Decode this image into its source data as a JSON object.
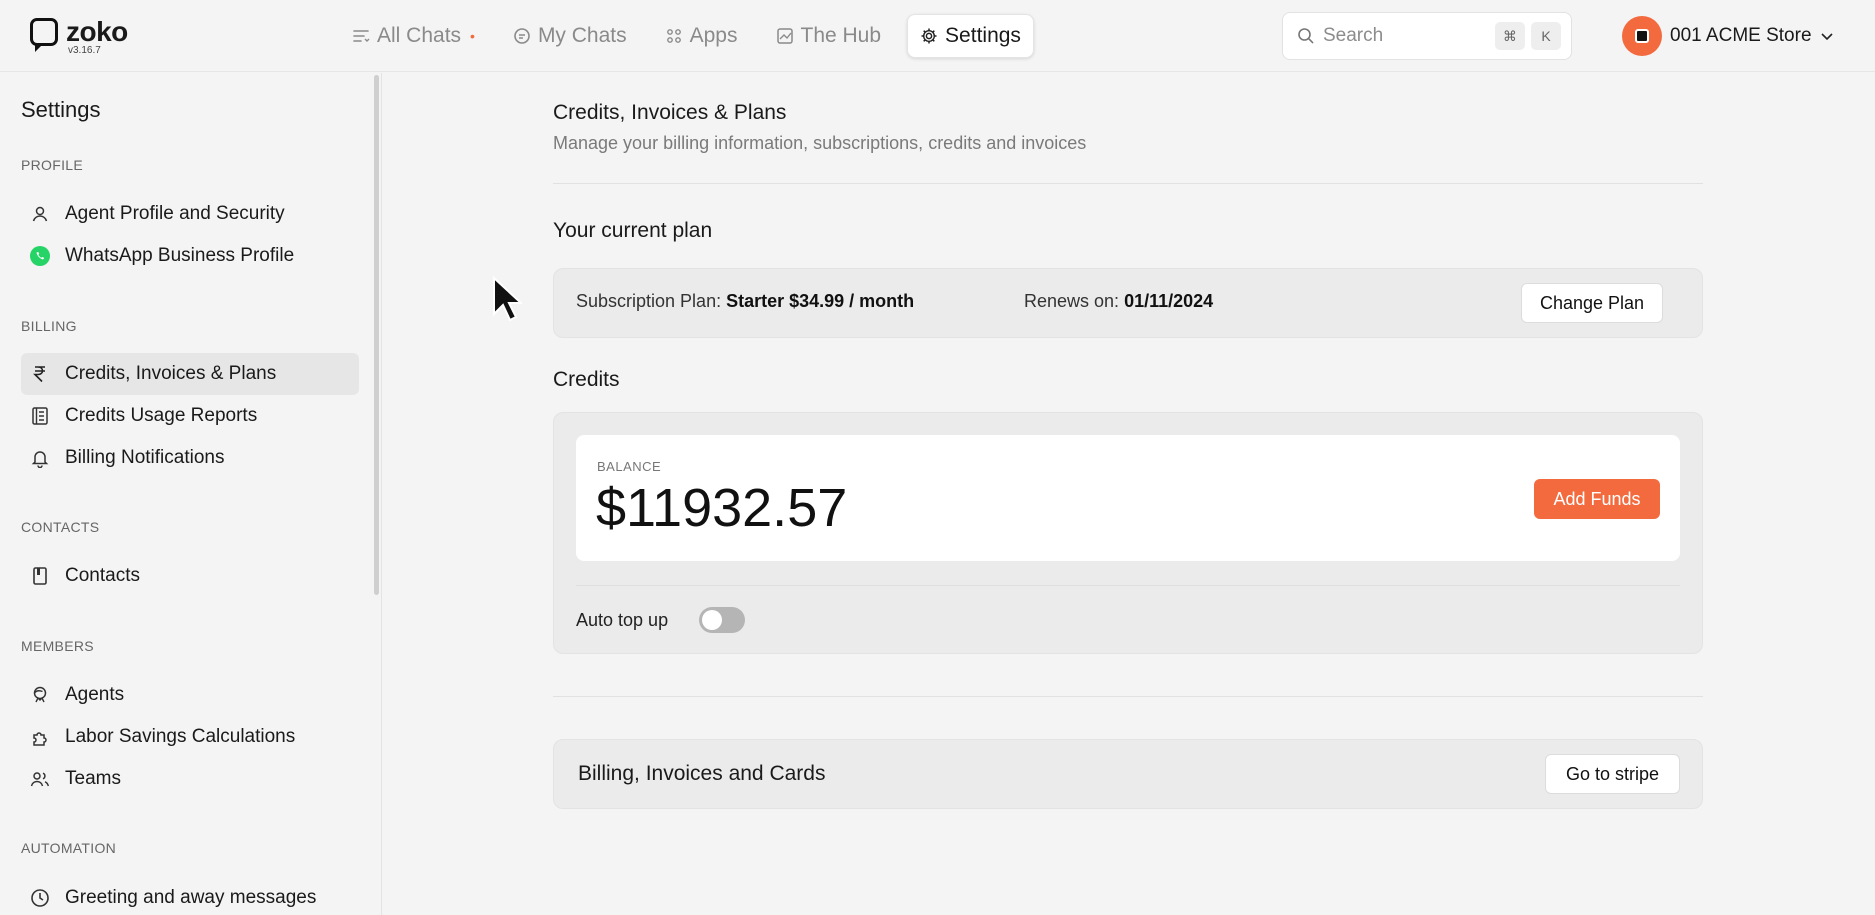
{
  "app": {
    "logo": "zoko",
    "version": "v3.16.7"
  },
  "nav": [
    {
      "label": "All Chats",
      "icon": "list-icon",
      "dot": "•"
    },
    {
      "label": "My Chats",
      "icon": "chat-icon"
    },
    {
      "label": "Apps",
      "icon": "apps-grid-icon"
    },
    {
      "label": "The Hub",
      "icon": "chart-icon"
    },
    {
      "label": "Settings",
      "icon": "gear-icon",
      "active": true
    }
  ],
  "search": {
    "placeholder": "Search",
    "kbd1": "⌘",
    "kbd2": "K"
  },
  "account": {
    "name": "001 ACME Store"
  },
  "sidebar": {
    "title": "Settings",
    "sections": [
      {
        "label": "PROFILE",
        "items": [
          {
            "label": "Agent Profile and Security",
            "icon": "user-icon"
          },
          {
            "label": "WhatsApp Business Profile",
            "icon": "whatsapp-icon"
          }
        ]
      },
      {
        "label": "BILLING",
        "items": [
          {
            "label": "Credits, Invoices & Plans",
            "icon": "rupee-icon",
            "active": true
          },
          {
            "label": "Credits Usage Reports",
            "icon": "report-icon"
          },
          {
            "label": "Billing Notifications",
            "icon": "bell-icon"
          }
        ]
      },
      {
        "label": "CONTACTS",
        "items": [
          {
            "label": "Contacts",
            "icon": "contacts-book-icon"
          }
        ]
      },
      {
        "label": "MEMBERS",
        "items": [
          {
            "label": "Agents",
            "icon": "agent-icon"
          },
          {
            "label": "Labor Savings Calculations",
            "icon": "puzzle-icon"
          },
          {
            "label": "Teams",
            "icon": "team-icon"
          }
        ]
      },
      {
        "label": "AUTOMATION",
        "items": [
          {
            "label": "Greeting and away messages",
            "icon": "clock-icon"
          }
        ]
      }
    ]
  },
  "main": {
    "title": "Credits, Invoices & Plans",
    "subtitle": "Manage your billing information, subscriptions, credits and invoices",
    "plan": {
      "heading": "Your current plan",
      "sub_label": "Subscription Plan: ",
      "sub_value": "Starter $34.99 / month",
      "renew_label": "Renews on: ",
      "renew_value": "01/11/2024",
      "change_button": "Change Plan"
    },
    "credits": {
      "heading": "Credits",
      "balance_label": "BALANCE",
      "balance_value": "$11932.57",
      "add_funds": "Add Funds",
      "auto_topup_label": "Auto top up",
      "auto_topup_on": false
    },
    "billing": {
      "title": "Billing, Invoices and Cards",
      "stripe_button": "Go to stripe"
    }
  },
  "colors": {
    "accent": "#f26a3d",
    "whatsapp": "#25d366"
  }
}
